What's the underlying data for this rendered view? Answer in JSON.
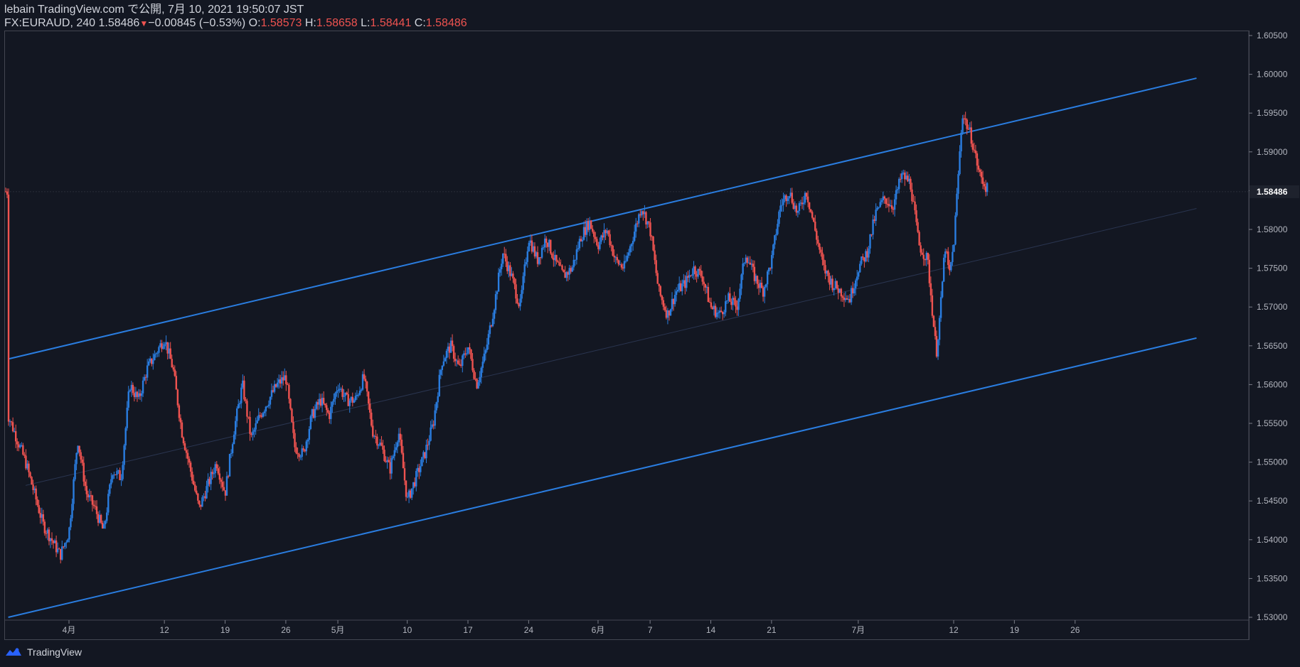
{
  "header": {
    "publish_line": "lebain TradingView.com で公開, 7月 10, 2021 19:50:07 JST",
    "symbol_info": "FX:EURAUD, 240 1.58486",
    "change": "−0.00845 (−0.53%)",
    "o_label": "O:",
    "o_value": "1.58573",
    "h_label": "H:",
    "h_value": "1.58658",
    "l_label": "L:",
    "l_value": "1.58441",
    "c_label": "C:",
    "c_value": "1.58486"
  },
  "footer": {
    "brand": "TradingView"
  },
  "colors": {
    "background": "#131722",
    "up": "#2a7de0",
    "down": "#ef5350",
    "channel": "#2a7de0",
    "grid_border": "#434651"
  },
  "chart_data": {
    "type": "candlestick",
    "symbol": "FX:EURAUD",
    "interval": "240",
    "last_price": "1.58486",
    "ylim": [
      1.53,
      1.605
    ],
    "y_ticks": [
      "1.60500",
      "1.60000",
      "1.59500",
      "1.59000",
      "1.58500",
      "1.58000",
      "1.57500",
      "1.57000",
      "1.56500",
      "1.56000",
      "1.55500",
      "1.55000",
      "1.54500",
      "1.54000",
      "1.53500",
      "1.53000"
    ],
    "x_ticks": [
      "4月",
      "12",
      "19",
      "26",
      "5月",
      "10",
      "17",
      "24",
      "6月",
      "7",
      "14",
      "21",
      "7月",
      "12",
      "19",
      "26"
    ],
    "x_tick_days": [
      1,
      12,
      19,
      26,
      32,
      40,
      47,
      54,
      62,
      68,
      75,
      82,
      92,
      103,
      110,
      117
    ],
    "channel": {
      "upper": [
        {
          "day": -6,
          "price": 1.5633
        },
        {
          "day": 131,
          "price": 1.5995
        }
      ],
      "lower": [
        {
          "day": -6,
          "price": 1.53
        },
        {
          "day": 131,
          "price": 1.566
        }
      ],
      "mid": [
        {
          "day": -4,
          "price": 1.547
        },
        {
          "day": 131,
          "price": 1.5827
        }
      ]
    },
    "price_path": [
      [
        -6,
        1.556
      ],
      [
        -4,
        1.55
      ],
      [
        -2,
        1.542
      ],
      [
        0,
        1.538
      ],
      [
        1,
        1.541
      ],
      [
        2,
        1.553
      ],
      [
        3,
        1.546
      ],
      [
        4,
        1.544
      ],
      [
        5,
        1.541
      ],
      [
        6,
        1.549
      ],
      [
        7,
        1.548
      ],
      [
        8,
        1.56
      ],
      [
        9,
        1.558
      ],
      [
        10,
        1.562
      ],
      [
        11,
        1.564
      ],
      [
        12,
        1.566
      ],
      [
        13,
        1.562
      ],
      [
        14,
        1.554
      ],
      [
        15,
        1.549
      ],
      [
        16,
        1.544
      ],
      [
        17,
        1.547
      ],
      [
        18,
        1.55
      ],
      [
        19,
        1.546
      ],
      [
        20,
        1.554
      ],
      [
        21,
        1.56
      ],
      [
        22,
        1.553
      ],
      [
        23,
        1.556
      ],
      [
        24,
        1.558
      ],
      [
        25,
        1.56
      ],
      [
        26,
        1.561
      ],
      [
        27,
        1.552
      ],
      [
        28,
        1.551
      ],
      [
        29,
        1.556
      ],
      [
        30,
        1.558
      ],
      [
        31,
        1.556
      ],
      [
        32,
        1.56
      ],
      [
        33,
        1.558
      ],
      [
        34,
        1.558
      ],
      [
        35,
        1.561
      ],
      [
        36,
        1.554
      ],
      [
        37,
        1.552
      ],
      [
        38,
        1.549
      ],
      [
        39,
        1.554
      ],
      [
        40,
        1.545
      ],
      [
        41,
        1.548
      ],
      [
        42,
        1.551
      ],
      [
        43,
        1.555
      ],
      [
        44,
        1.563
      ],
      [
        45,
        1.565
      ],
      [
        46,
        1.562
      ],
      [
        47,
        1.565
      ],
      [
        48,
        1.56
      ],
      [
        49,
        1.564
      ],
      [
        50,
        1.57
      ],
      [
        51,
        1.577
      ],
      [
        52,
        1.574
      ],
      [
        53,
        1.57
      ],
      [
        54,
        1.579
      ],
      [
        55,
        1.576
      ],
      [
        56,
        1.579
      ],
      [
        57,
        1.576
      ],
      [
        58,
        1.574
      ],
      [
        59,
        1.575
      ],
      [
        60,
        1.579
      ],
      [
        61,
        1.581
      ],
      [
        62,
        1.578
      ],
      [
        63,
        1.58
      ],
      [
        64,
        1.576
      ],
      [
        65,
        1.575
      ],
      [
        66,
        1.579
      ],
      [
        67,
        1.583
      ],
      [
        68,
        1.58
      ],
      [
        69,
        1.572
      ],
      [
        70,
        1.569
      ],
      [
        71,
        1.572
      ],
      [
        72,
        1.573
      ],
      [
        73,
        1.575
      ],
      [
        74,
        1.574
      ],
      [
        75,
        1.57
      ],
      [
        76,
        1.569
      ],
      [
        77,
        1.571
      ],
      [
        78,
        1.57
      ],
      [
        79,
        1.577
      ],
      [
        80,
        1.574
      ],
      [
        81,
        1.572
      ],
      [
        82,
        1.576
      ],
      [
        83,
        1.583
      ],
      [
        84,
        1.585
      ],
      [
        85,
        1.582
      ],
      [
        86,
        1.585
      ],
      [
        87,
        1.58
      ],
      [
        88,
        1.575
      ],
      [
        89,
        1.573
      ],
      [
        90,
        1.572
      ],
      [
        91,
        1.571
      ],
      [
        92,
        1.575
      ],
      [
        93,
        1.577
      ],
      [
        94,
        1.582
      ],
      [
        95,
        1.584
      ],
      [
        96,
        1.583
      ],
      [
        97,
        1.587
      ],
      [
        98,
        1.586
      ],
      [
        99,
        1.578
      ],
      [
        100,
        1.576
      ],
      [
        101,
        1.564
      ],
      [
        101.5,
        1.57
      ],
      [
        102,
        1.578
      ],
      [
        102.5,
        1.574
      ],
      [
        103,
        1.578
      ],
      [
        104,
        1.595
      ],
      [
        105,
        1.592
      ],
      [
        106,
        1.587
      ],
      [
        107,
        1.5849
      ]
    ]
  }
}
